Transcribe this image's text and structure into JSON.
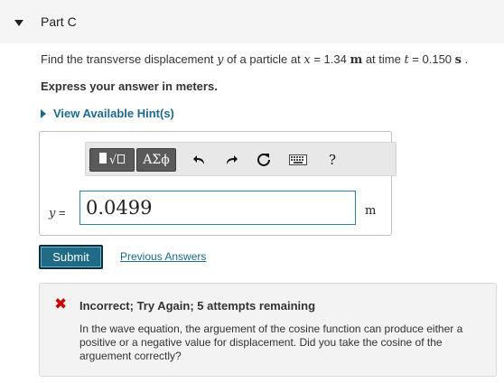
{
  "part": {
    "title": "Part C"
  },
  "problem": {
    "prefix": "Find the transverse displacement ",
    "var_y": "y",
    "mid1": " of a particle at ",
    "var_x": "x",
    "eq1": " = 1.34 ",
    "unit_m": "m",
    "mid2": " at time ",
    "var_t": "t",
    "eq2": " = 0.150 ",
    "unit_s": "s",
    "end": " ."
  },
  "express": "Express your answer in meters.",
  "hint": {
    "label": "View Available Hint(s)"
  },
  "toolbar": {
    "templates_icon": "templates-icon",
    "greek_label": "ΑΣϕ",
    "undo_icon": "undo-icon",
    "redo_icon": "redo-icon",
    "reset_icon": "reset-icon",
    "keyboard_icon": "keyboard-icon",
    "help_label": "?"
  },
  "answer": {
    "var_label": "y",
    "equals": " = ",
    "value": "0.0499",
    "unit": "m"
  },
  "actions": {
    "submit_label": "Submit",
    "previous_answers_label": "Previous Answers"
  },
  "feedback": {
    "icon": "✖",
    "title": "Incorrect; Try Again; 5 attempts remaining",
    "message": "In the wave equation, the arguement of the cosine function can produce either a positive or a negative value for displacement. Did you take the cosine of the arguement correctly?",
    "color": "#cc0000"
  }
}
